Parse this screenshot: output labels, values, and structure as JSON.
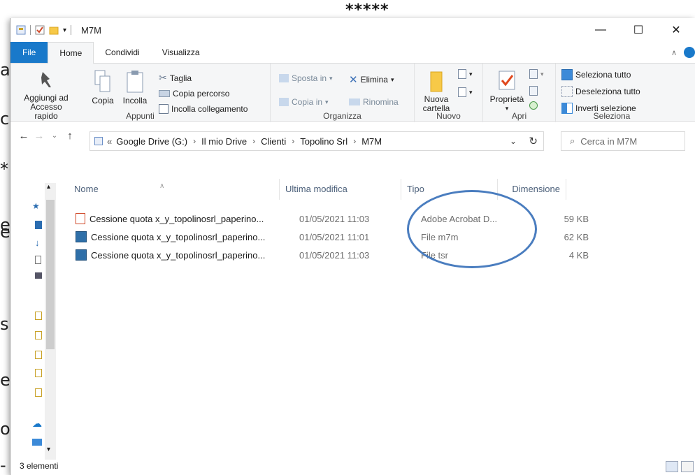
{
  "background": {
    "stars": "*****",
    "edge_letters": [
      "a",
      "c",
      "*",
      "e",
      "e",
      "s",
      "e",
      "o",
      "-"
    ]
  },
  "titlebar": {
    "folder_title": "M7M",
    "minimize": "—",
    "maximize": "☐",
    "close": "✕"
  },
  "tabs": [
    {
      "label": "File"
    },
    {
      "label": "Home"
    },
    {
      "label": "Condividi"
    },
    {
      "label": "Visualizza"
    }
  ],
  "ribbon": {
    "appunti": {
      "label": "Appunti",
      "pin_label_1": "Aggiungi ad",
      "pin_label_2": "Accesso rapido",
      "copy": "Copia",
      "paste": "Incolla",
      "cut": "Taglia",
      "copy_path": "Copia percorso",
      "paste_link": "Incolla collegamento"
    },
    "organizza": {
      "label": "Organizza",
      "move_to": "Sposta in",
      "copy_to": "Copia in",
      "delete": "Elimina",
      "rename": "Rinomina"
    },
    "nuovo": {
      "label": "Nuovo",
      "new_folder_1": "Nuova",
      "new_folder_2": "cartella"
    },
    "apri": {
      "label": "Apri",
      "properties": "Proprietà"
    },
    "seleziona": {
      "label": "Seleziona",
      "select_all": "Seleziona tutto",
      "deselect_all": "Deseleziona tutto",
      "invert": "Inverti selezione"
    }
  },
  "address": {
    "overflow": "«",
    "crumbs": [
      "Google Drive (G:)",
      "Il mio Drive",
      "Clienti",
      "Topolino Srl",
      "M7M"
    ],
    "search_placeholder": "Cerca in M7M"
  },
  "columns": {
    "name": "Nome",
    "modified": "Ultima modifica",
    "type": "Tipo",
    "size": "Dimensione"
  },
  "files": [
    {
      "name": "Cessione quota x_y_topolinosrl_paperino...",
      "modified": "01/05/2021 11:03",
      "type": "Adobe Acrobat D...",
      "size": "59 KB",
      "icon": "pdf-icon"
    },
    {
      "name": "Cessione quota x_y_topolinosrl_paperino...",
      "modified": "01/05/2021 11:01",
      "type": "File m7m",
      "size": "62 KB",
      "icon": "signed-file-icon"
    },
    {
      "name": "Cessione quota x_y_topolinosrl_paperino...",
      "modified": "01/05/2021 11:03",
      "type": "File tsr",
      "size": "4 KB",
      "icon": "signed-file-icon"
    }
  ],
  "status": {
    "count": "3 elementi"
  },
  "colors": {
    "accent": "#1979ca",
    "annotation": "#4a7dbf",
    "ribbon_bg": "#f5f6f7"
  }
}
